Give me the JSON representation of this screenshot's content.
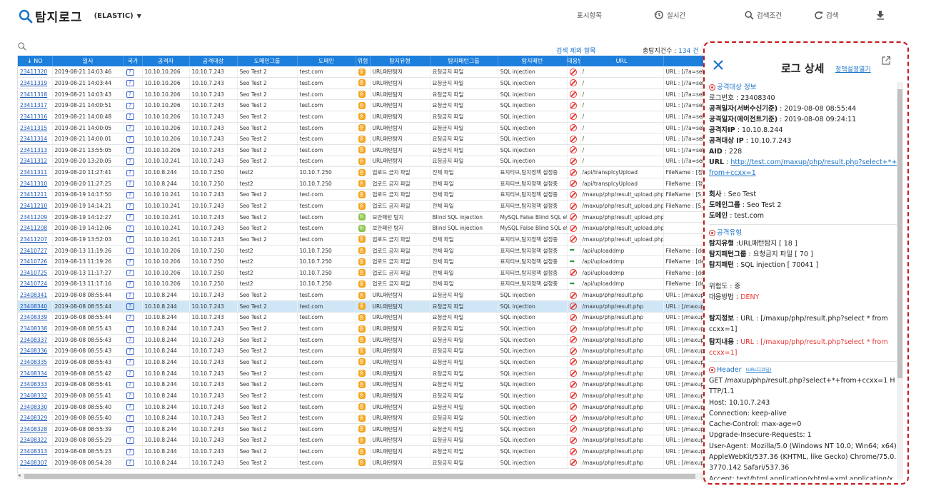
{
  "app": {
    "title": "탐지로그",
    "source": "(ELASTIC)"
  },
  "toolbar": {
    "display_items": "표시항목",
    "realtime": "실시간",
    "search_conditions": "검색조건",
    "search": "검색"
  },
  "meta": {
    "exclude_label": "검색 제외 항목",
    "count_label": "총탐지건수 :",
    "count_value": "134 건"
  },
  "columns": [
    "↓ NO",
    "일시",
    "국가",
    "공격자",
    "공격대상",
    "도메인그룹",
    "도메인",
    "위험",
    "탐지유형",
    "탐지패턴그룹",
    "탐지패턴",
    "대응방법",
    "URL",
    ""
  ],
  "rows": [
    {
      "no": "23411320",
      "dt": "2019-08-21 14:03:46",
      "cc": "?",
      "src": "10.10.10.206",
      "dst": "10.10.7.243",
      "grp": "Seo Test 2",
      "dom": "test.com",
      "risk": "high",
      "type": "URL패턴탐지",
      "pgrp": "요청금지 파일",
      "pat": "SQL injection",
      "act": "deny",
      "url": "/",
      "info": "URL : [/?a=select * from"
    },
    {
      "no": "23411319",
      "dt": "2019-08-21 14:03:44",
      "cc": "?",
      "src": "10.10.10.206",
      "dst": "10.10.7.243",
      "grp": "Seo Test 2",
      "dom": "test.com",
      "risk": "high",
      "type": "URL패턴탐지",
      "pgrp": "요청금지 파일",
      "pat": "SQL injection",
      "act": "deny",
      "url": "/",
      "info": "URL : [/?a=select * from"
    },
    {
      "no": "23411318",
      "dt": "2019-08-21 14:03:43",
      "cc": "?",
      "src": "10.10.10.206",
      "dst": "10.10.7.243",
      "grp": "Seo Test 2",
      "dom": "test.com",
      "risk": "high",
      "type": "URL패턴탐지",
      "pgrp": "요청금지 파일",
      "pat": "SQL injection",
      "act": "deny",
      "url": "/",
      "info": "URL : [/?a=select * from"
    },
    {
      "no": "23411317",
      "dt": "2019-08-21 14:00:51",
      "cc": "?",
      "src": "10.10.10.206",
      "dst": "10.10.7.243",
      "grp": "Seo Test 2",
      "dom": "test.com",
      "risk": "high",
      "type": "URL패턴탐지",
      "pgrp": "요청금지 파일",
      "pat": "SQL injection",
      "act": "deny",
      "url": "/",
      "info": "URL : [/?a=select * from"
    },
    {
      "no": "23411316",
      "dt": "2019-08-21 14:00:48",
      "cc": "?",
      "src": "10.10.10.206",
      "dst": "10.10.7.243",
      "grp": "Seo Test 2",
      "dom": "test.com",
      "risk": "high",
      "type": "URL패턴탐지",
      "pgrp": "요청금지 파일",
      "pat": "SQL injection",
      "act": "deny",
      "url": "/",
      "info": "URL : [/?a=select * from"
    },
    {
      "no": "23411315",
      "dt": "2019-08-21 14:00:05",
      "cc": "?",
      "src": "10.10.10.206",
      "dst": "10.10.7.243",
      "grp": "Seo Test 2",
      "dom": "test.com",
      "risk": "high",
      "type": "URL패턴탐지",
      "pgrp": "요청금지 파일",
      "pat": "SQL injection",
      "act": "deny",
      "url": "/",
      "info": "URL : [/?a=select * from"
    },
    {
      "no": "23411314",
      "dt": "2019-08-21 14:00:01",
      "cc": "?",
      "src": "10.10.10.206",
      "dst": "10.10.7.243",
      "grp": "Seo Test 2",
      "dom": "test.com",
      "risk": "high",
      "type": "URL패턴탐지",
      "pgrp": "요청금지 파일",
      "pat": "SQL injection",
      "act": "deny",
      "url": "/",
      "info": "URL : [/?a=select * from"
    },
    {
      "no": "23411313",
      "dt": "2019-08-21 13:55:05",
      "cc": "?",
      "src": "10.10.10.206",
      "dst": "10.10.7.243",
      "grp": "Seo Test 2",
      "dom": "test.com",
      "risk": "high",
      "type": "URL패턴탐지",
      "pgrp": "요청금지 파일",
      "pat": "SQL injection",
      "act": "deny",
      "url": "/",
      "info": "URL : [/?a=select * from"
    },
    {
      "no": "23411312",
      "dt": "2019-08-20 13:20:05",
      "cc": "?",
      "src": "10.10.10.241",
      "dst": "10.10.7.243",
      "grp": "Seo Test 2",
      "dom": "test.com",
      "risk": "high",
      "type": "URL패턴탐지",
      "pgrp": "요청금지 파일",
      "pat": "SQL injection",
      "act": "deny",
      "url": "/",
      "info": "URL : [/?a=select * from"
    },
    {
      "no": "23411311",
      "dt": "2019-08-20 11:27:41",
      "cc": "?",
      "src": "10.10.8.244",
      "dst": "10.10.7.250",
      "grp": "test2",
      "dom": "10.10.7.250",
      "risk": "high",
      "type": "업로드 금지 파일",
      "pgrp": "전체 파일",
      "pat": "표지티브,탐지정책 설정중",
      "act": "deny",
      "url": "/api/transplcyUpload",
      "info": "FileName : [정책테스트"
    },
    {
      "no": "23411310",
      "dt": "2019-08-20 11:27:25",
      "cc": "?",
      "src": "10.10.8.244",
      "dst": "10.10.7.250",
      "grp": "test2",
      "dom": "10.10.7.250",
      "risk": "high",
      "type": "업로드 금지 파일",
      "pgrp": "전체 파일",
      "pat": "표지티브,탐지정책 설정중",
      "act": "deny",
      "url": "/api/transplcyUpload",
      "info": "FileName : [정책테스트"
    },
    {
      "no": "23411211",
      "dt": "2019-08-19 14:17:50",
      "cc": "?",
      "src": "10.10.10.241",
      "dst": "10.10.7.243",
      "grp": "Seo Test 2",
      "dom": "test.com",
      "risk": "high",
      "type": "업로드 금지 파일",
      "pgrp": "전체 파일",
      "pat": "표지티브,탐지정책 설정중",
      "act": "deny",
      "url": "/maxup/php/result_upload.php",
      "info": "FileName : [S.T.A.R.%b"
    },
    {
      "no": "23411210",
      "dt": "2019-08-19 14:14:21",
      "cc": "?",
      "src": "10.10.10.241",
      "dst": "10.10.7.243",
      "grp": "Seo Test 2",
      "dom": "test.com",
      "risk": "high",
      "type": "업로드 금지 파일",
      "pgrp": "전체 파일",
      "pat": "표지티브,탐지정책 설정중",
      "act": "deny",
      "url": "/maxup/php/result_upload.php",
      "info": "FileName : [S.T.A.R.%b"
    },
    {
      "no": "23411209",
      "dt": "2019-08-19 14:12:27",
      "cc": "?",
      "src": "10.10.10.241",
      "dst": "10.10.7.243",
      "grp": "Seo Test 2",
      "dom": "test.com",
      "risk": "mid",
      "type": "보안패턴 탐지",
      "pgrp": "Blind SQL injection",
      "pat": "MySQL False Blind SQL etc",
      "act": "deny",
      "url": "/maxup/php/result_upload.php",
      "info": ""
    },
    {
      "no": "23411208",
      "dt": "2019-08-19 14:12:06",
      "cc": "?",
      "src": "10.10.10.241",
      "dst": "10.10.7.243",
      "grp": "Seo Test 2",
      "dom": "test.com",
      "risk": "mid",
      "type": "보안패턴 탐지",
      "pgrp": "Blind SQL injection",
      "pat": "MySQL False Blind SQL etc",
      "act": "deny",
      "url": "/maxup/php/result_upload.php",
      "info": ""
    },
    {
      "no": "23411207",
      "dt": "2019-08-19 13:52:03",
      "cc": "?",
      "src": "10.10.10.241",
      "dst": "10.10.7.243",
      "grp": "Seo Test 2",
      "dom": "test.com",
      "risk": "high",
      "type": "업로드 금지 파일",
      "pgrp": "전체 파일",
      "pat": "표지티브,탐지정책 설정중",
      "act": "deny",
      "url": "/maxup/php/result_upload.php",
      "info": ""
    },
    {
      "no": "23410727",
      "dt": "2019-08-13 11:19:26",
      "cc": "?",
      "src": "10.10.10.206",
      "dst": "10.10.7.250",
      "grp": "test2",
      "dom": "10.10.7.250",
      "risk": "high",
      "type": "업로드 금지 파일",
      "pgrp": "전체 파일",
      "pat": "표지티브,탐지정책 설정중",
      "act": "pass",
      "url": "/api/uploaddmp",
      "info": "FileName : [deepFinder"
    },
    {
      "no": "23410726",
      "dt": "2019-08-13 11:19:26",
      "cc": "?",
      "src": "10.10.10.206",
      "dst": "10.10.7.250",
      "grp": "test2",
      "dom": "10.10.7.250",
      "risk": "high",
      "type": "업로드 금지 파일",
      "pgrp": "전체 파일",
      "pat": "표지티브,탐지정책 설정중",
      "act": "pass",
      "url": "/api/uploaddmp",
      "info": "FileName : [deepFinder"
    },
    {
      "no": "23410725",
      "dt": "2019-08-13 11:17:27",
      "cc": "?",
      "src": "10.10.10.206",
      "dst": "10.10.7.250",
      "grp": "test2",
      "dom": "10.10.7.250",
      "risk": "high",
      "type": "업로드 금지 파일",
      "pgrp": "전체 파일",
      "pat": "표지티브,탐지정책 설정중",
      "act": "deny",
      "url": "/api/uploaddmp",
      "info": "FileName : [deepFinder"
    },
    {
      "no": "23410724",
      "dt": "2019-08-13 11:17:16",
      "cc": "?",
      "src": "10.10.10.206",
      "dst": "10.10.7.250",
      "grp": "test2",
      "dom": "10.10.7.250",
      "risk": "high",
      "type": "업로드 금지 파일",
      "pgrp": "전체 파일",
      "pat": "표지티브,탐지정책 설정중",
      "act": "pass",
      "url": "/api/uploaddmp",
      "info": "FileName : [deepFinder"
    },
    {
      "no": "23408341",
      "dt": "2019-08-08 08:55:44",
      "cc": "?",
      "src": "10.10.8.244",
      "dst": "10.10.7.243",
      "grp": "Seo Test 2",
      "dom": "test.com",
      "risk": "high",
      "type": "URL패턴탐지",
      "pgrp": "요청금지 파일",
      "pat": "SQL injection",
      "act": "deny",
      "url": "/maxup/php/result.php",
      "info": "URL : [/maxup/php/res"
    },
    {
      "no": "23408340",
      "dt": "2019-08-08 08:55:44",
      "cc": "?",
      "src": "10.10.8.244",
      "dst": "10.10.7.243",
      "grp": "Seo Test 2",
      "dom": "test.com",
      "risk": "high",
      "type": "URL패턴탐지",
      "pgrp": "요청금지 파일",
      "pat": "SQL injection",
      "act": "deny",
      "url": "/maxup/php/result.php",
      "info": "URL : [/maxup/php/res",
      "sel": true
    },
    {
      "no": "23408339",
      "dt": "2019-08-08 08:55:44",
      "cc": "?",
      "src": "10.10.8.244",
      "dst": "10.10.7.243",
      "grp": "Seo Test 2",
      "dom": "test.com",
      "risk": "high",
      "type": "URL패턴탐지",
      "pgrp": "요청금지 파일",
      "pat": "SQL injection",
      "act": "deny",
      "url": "/maxup/php/result.php",
      "info": "URL : [/maxup/php/res"
    },
    {
      "no": "23408338",
      "dt": "2019-08-08 08:55:43",
      "cc": "?",
      "src": "10.10.8.244",
      "dst": "10.10.7.243",
      "grp": "Seo Test 2",
      "dom": "test.com",
      "risk": "high",
      "type": "URL패턴탐지",
      "pgrp": "요청금지 파일",
      "pat": "SQL injection",
      "act": "deny",
      "url": "/maxup/php/result.php",
      "info": "URL : [/maxup/php/res"
    },
    {
      "no": "23408337",
      "dt": "2019-08-08 08:55:43",
      "cc": "?",
      "src": "10.10.8.244",
      "dst": "10.10.7.243",
      "grp": "Seo Test 2",
      "dom": "test.com",
      "risk": "high",
      "type": "URL패턴탐지",
      "pgrp": "요청금지 파일",
      "pat": "SQL injection",
      "act": "deny",
      "url": "/maxup/php/result.php",
      "info": "URL : [/maxup/php/res"
    },
    {
      "no": "23408336",
      "dt": "2019-08-08 08:55:43",
      "cc": "?",
      "src": "10.10.8.244",
      "dst": "10.10.7.243",
      "grp": "Seo Test 2",
      "dom": "test.com",
      "risk": "high",
      "type": "URL패턴탐지",
      "pgrp": "요청금지 파일",
      "pat": "SQL injection",
      "act": "deny",
      "url": "/maxup/php/result.php",
      "info": "URL : [/maxup/php/res"
    },
    {
      "no": "23408335",
      "dt": "2019-08-08 08:55:43",
      "cc": "?",
      "src": "10.10.8.244",
      "dst": "10.10.7.243",
      "grp": "Seo Test 2",
      "dom": "test.com",
      "risk": "high",
      "type": "URL패턴탐지",
      "pgrp": "요청금지 파일",
      "pat": "SQL injection",
      "act": "deny",
      "url": "/maxup/php/result.php",
      "info": "URL : [/maxup/php/res"
    },
    {
      "no": "23408334",
      "dt": "2019-08-08 08:55:42",
      "cc": "?",
      "src": "10.10.8.244",
      "dst": "10.10.7.243",
      "grp": "Seo Test 2",
      "dom": "test.com",
      "risk": "high",
      "type": "URL패턴탐지",
      "pgrp": "요청금지 파일",
      "pat": "SQL injection",
      "act": "deny",
      "url": "/maxup/php/result.php",
      "info": "URL : [/maxup/php/res"
    },
    {
      "no": "23408333",
      "dt": "2019-08-08 08:55:41",
      "cc": "?",
      "src": "10.10.8.244",
      "dst": "10.10.7.243",
      "grp": "Seo Test 2",
      "dom": "test.com",
      "risk": "high",
      "type": "URL패턴탐지",
      "pgrp": "요청금지 파일",
      "pat": "SQL injection",
      "act": "deny",
      "url": "/maxup/php/result.php",
      "info": "URL : [/maxup/php/res"
    },
    {
      "no": "23408332",
      "dt": "2019-08-08 08:55:41",
      "cc": "?",
      "src": "10.10.8.244",
      "dst": "10.10.7.243",
      "grp": "Seo Test 2",
      "dom": "test.com",
      "risk": "high",
      "type": "URL패턴탐지",
      "pgrp": "요청금지 파일",
      "pat": "SQL injection",
      "act": "deny",
      "url": "/maxup/php/result.php",
      "info": "URL : [/maxup/php/res"
    },
    {
      "no": "23408330",
      "dt": "2019-08-08 08:55:40",
      "cc": "?",
      "src": "10.10.8.244",
      "dst": "10.10.7.243",
      "grp": "Seo Test 2",
      "dom": "test.com",
      "risk": "high",
      "type": "URL패턴탐지",
      "pgrp": "요청금지 파일",
      "pat": "SQL injection",
      "act": "deny",
      "url": "/maxup/php/result.php",
      "info": "URL : [/maxup/php/res"
    },
    {
      "no": "23408329",
      "dt": "2019-08-08 08:55:40",
      "cc": "?",
      "src": "10.10.8.244",
      "dst": "10.10.7.243",
      "grp": "Seo Test 2",
      "dom": "test.com",
      "risk": "high",
      "type": "URL패턴탐지",
      "pgrp": "요청금지 파일",
      "pat": "SQL injection",
      "act": "deny",
      "url": "/maxup/php/result.php",
      "info": "URL : [/maxup/php/res"
    },
    {
      "no": "23408328",
      "dt": "2019-08-08 08:55:39",
      "cc": "?",
      "src": "10.10.8.244",
      "dst": "10.10.7.243",
      "grp": "Seo Test 2",
      "dom": "test.com",
      "risk": "high",
      "type": "URL패턴탐지",
      "pgrp": "요청금지 파일",
      "pat": "SQL injection",
      "act": "deny",
      "url": "/maxup/php/result.php",
      "info": "URL : [/maxup/php/res"
    },
    {
      "no": "23408322",
      "dt": "2019-08-08 08:55:29",
      "cc": "?",
      "src": "10.10.8.244",
      "dst": "10.10.7.243",
      "grp": "Seo Test 2",
      "dom": "test.com",
      "risk": "high",
      "type": "URL패턴탐지",
      "pgrp": "요청금지 파일",
      "pat": "SQL injection",
      "act": "deny",
      "url": "/maxup/php/result.php",
      "info": "URL : [/maxup/php/res"
    },
    {
      "no": "23408313",
      "dt": "2019-08-08 08:55:23",
      "cc": "?",
      "src": "10.10.8.244",
      "dst": "10.10.7.243",
      "grp": "Seo Test 2",
      "dom": "test.com",
      "risk": "high",
      "type": "URL패턴탐지",
      "pgrp": "요청금지 파일",
      "pat": "SQL injection",
      "act": "deny",
      "url": "/maxup/php/result.php",
      "info": "URL : [/maxup/php/res"
    },
    {
      "no": "23408307",
      "dt": "2019-08-08 08:54:28",
      "cc": "?",
      "src": "10.10.8.244",
      "dst": "10.10.7.243",
      "grp": "Seo Test 2",
      "dom": "test.com",
      "risk": "high",
      "type": "URL패턴탐지",
      "pgrp": "요청금지 파일",
      "pat": "SQL injection",
      "act": "deny",
      "url": "/maxup/php/result.php",
      "info": "URL : [/maxup/php/res"
    }
  ],
  "detail": {
    "title": "로그 상세",
    "policy_link": "정책설정열기",
    "target_section": "공격대상 정보",
    "log_no": "로그번호 : 23408340",
    "time_server_label": "공격일자(서버수신기준)",
    "time_server": " : 2019-08-08 08:55:44",
    "time_agent_label": "공격일자(에이전트기준)",
    "time_agent": " : 2019-08-08 09:24:11",
    "attacker_ip_label": "공격자IP",
    "attacker_ip": " : 10.10.8.244",
    "target_ip_label": "공격대상 IP",
    "target_ip": " : 10.10.7.243",
    "aid_label": "AID",
    "aid": " : 228",
    "url_label": "URL",
    "url_sep": " : ",
    "url": "http://test.com/maxup/php/result.php?select+*+from+ccxx=1",
    "company_label": "회사",
    "company": " : Seo Test",
    "domain_group_label": "도메인그룹",
    "domain_group": " : Seo Test 2",
    "domain_label": "도메인",
    "domain": " : test.com",
    "type_section": "공격유형",
    "detect_type_label": "탐지유형",
    "detect_type": " :URL패턴탐지 [ 18 ]",
    "pattern_group_label": "탐지패턴그룹",
    "pattern_group": " : 요청금지 파일 [ 70 ]",
    "pattern_label": "탐지패턴",
    "pattern": " : SQL injection [ 70041 ]",
    "risk_label": "위험도",
    "risk": " : 중",
    "action_label": "대응방법",
    "action_sep": " : ",
    "action": "DENY",
    "detect_info_label": "탐지정보",
    "detect_info": " : URL : [/maxup/php/result.php?select * from ccxx=1]",
    "detect_content_label": "탐지내용",
    "detect_content_sep": " : ",
    "detect_content": "URL : [/maxup/php/result.php?select * from ccxx=1]",
    "header_section": "Header",
    "header_link": "(URL디코딩)",
    "header_lines": [
      "GET /maxup/php/result.php?select+*+from+ccxx=1 HTTP/1.1",
      "Host: 10.10.7.243",
      "Connection: keep-alive",
      "Cache-Control: max-age=0",
      "Upgrade-Insecure-Requests: 1",
      "User-Agent: Mozilla/5.0 (Windows NT 10.0; Win64; x64) AppleWebKit/537.36 (KHTML, like Gecko) Chrome/75.0.3770.142 Safari/537.36",
      "Accept: text/html,application/xhtml+xml,application/xml"
    ]
  },
  "colors": {
    "primary": "#1d7fdc",
    "deny": "#e53935",
    "highlight": "#c5191b"
  }
}
